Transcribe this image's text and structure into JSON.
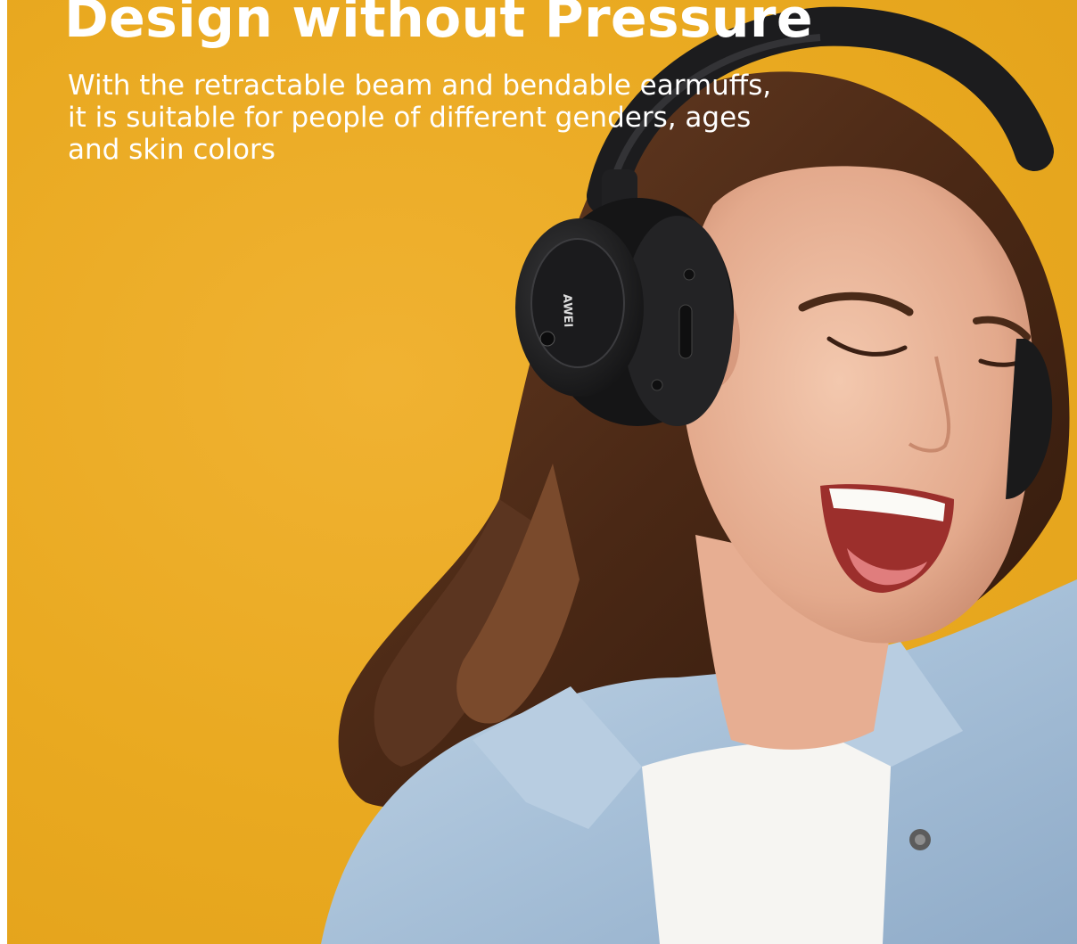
{
  "headline": "Design without Pressure",
  "description_lines": [
    "With the retractable beam and bendable earmuffs,",
    "it is suitable for people of different genders, ages",
    "and skin colors"
  ],
  "brand_mark": "AWEI",
  "colors": {
    "background": "#e9a920",
    "headline_text": "#ffffff",
    "headphones": "#1c1c1e",
    "shirt": "#a9c3dc"
  },
  "icons": [
    "headphones",
    "woman-portrait"
  ]
}
